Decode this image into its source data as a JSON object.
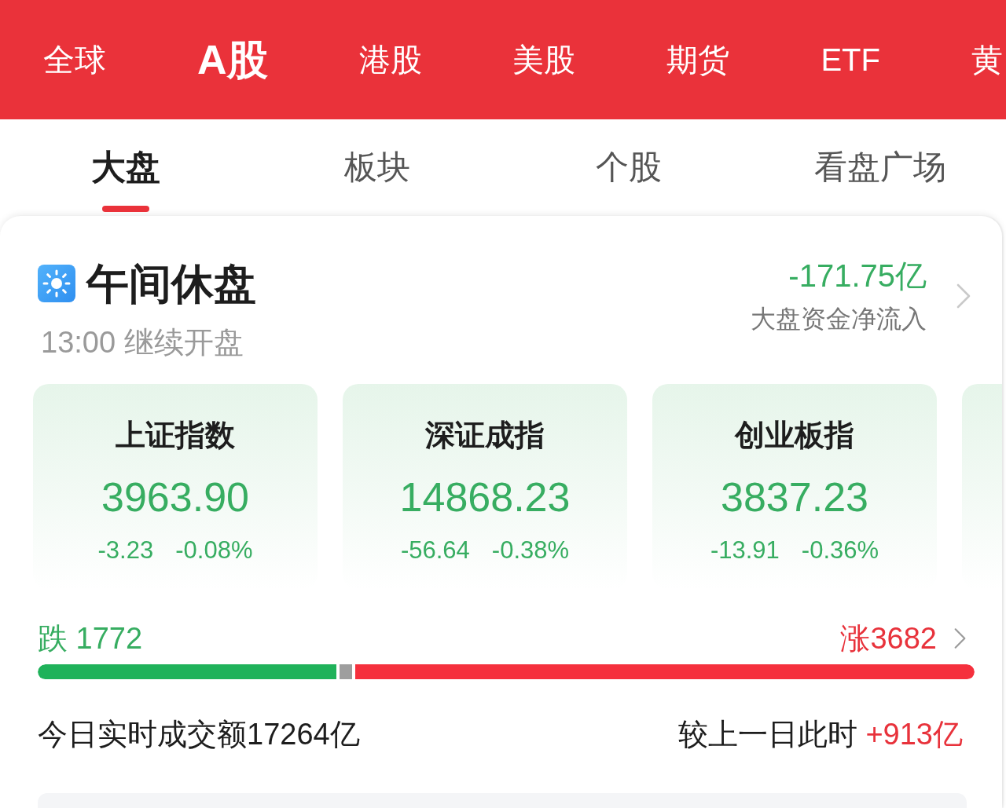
{
  "market_tabs": [
    {
      "label": "全球",
      "selected": false
    },
    {
      "label": "A股",
      "selected": true
    },
    {
      "label": "港股",
      "selected": false
    },
    {
      "label": "美股",
      "selected": false
    },
    {
      "label": "期货",
      "selected": false
    },
    {
      "label": "ETF",
      "selected": false
    },
    {
      "label": "黄",
      "selected": false
    }
  ],
  "view_tabs": [
    {
      "label": "大盘",
      "selected": true
    },
    {
      "label": "板块",
      "selected": false
    },
    {
      "label": "个股",
      "selected": false
    },
    {
      "label": "看盘广场",
      "selected": false
    }
  ],
  "session": {
    "title": "午间休盘",
    "subtitle": "13:00 继续开盘",
    "net_flow": "-171.75亿",
    "net_flow_label": "大盘资金净流入"
  },
  "indices": [
    {
      "name": "上证指数",
      "value": "3963.90",
      "change": "-3.23",
      "change_pct": "-0.08%"
    },
    {
      "name": "深证成指",
      "value": "14868.23",
      "change": "-56.64",
      "change_pct": "-0.38%"
    },
    {
      "name": "创业板指",
      "value": "3837.23",
      "change": "-13.91",
      "change_pct": "-0.36%"
    }
  ],
  "breadth": {
    "fall": "跌 1772",
    "rise": "涨3682",
    "fall_bar": {
      "level": 0.319
    }
  },
  "turnover": {
    "total": "今日实时成交额17264亿",
    "compare_label": "较上一日此时",
    "compare_value": "+913亿"
  }
}
